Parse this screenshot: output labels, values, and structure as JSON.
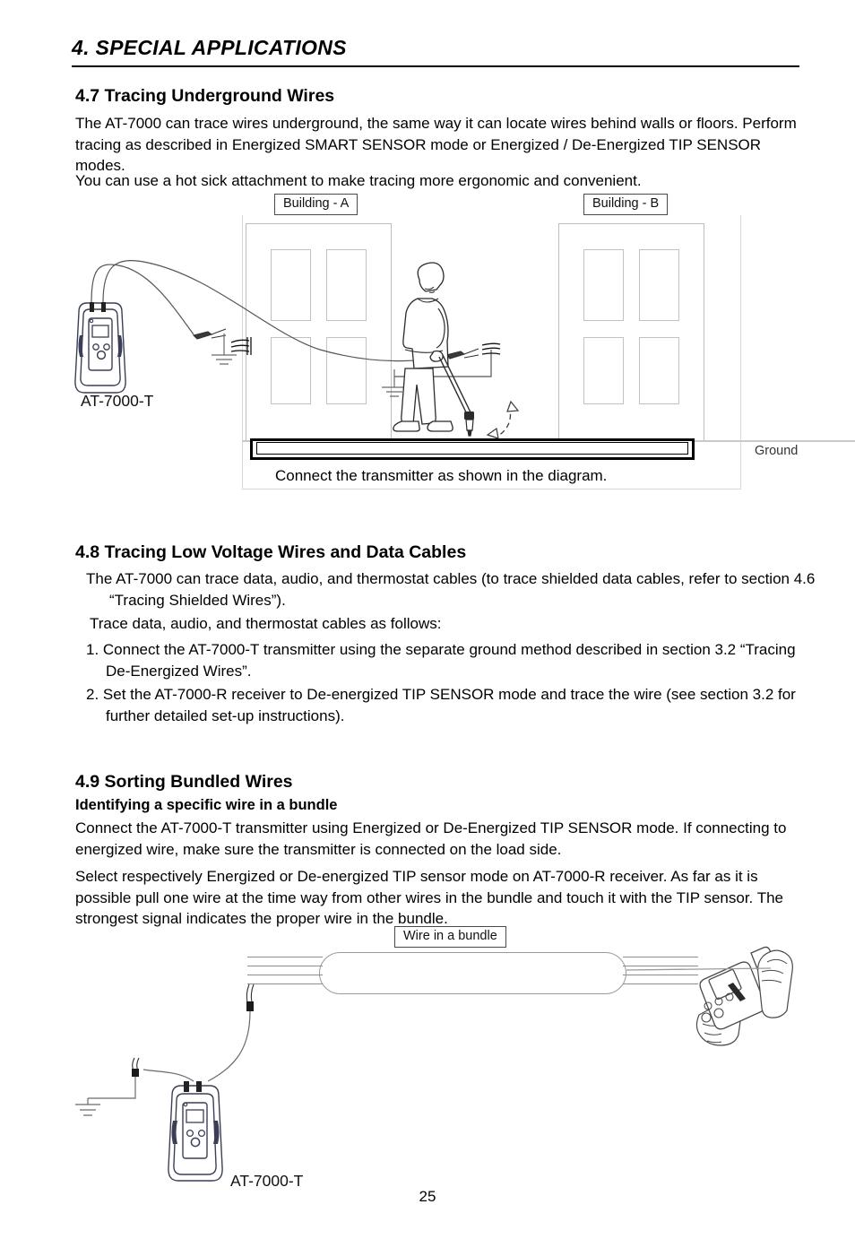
{
  "document": {
    "chapter_title": "4. SPECIAL APPLICATIONS",
    "page_number": "25"
  },
  "section_4_7": {
    "heading": "4.7 Tracing Underground Wires",
    "paragraphs": [
      "The AT-7000 can trace wires underground, the same way it can locate wires behind walls or floors. Perform tracing as described in Energized SMART SENSOR mode or Energized / De-Energized TIP SENSOR modes.",
      "You can use a hot sick attachment to make tracing more ergonomic and convenient."
    ],
    "figure": {
      "building_a_label": "Building - A",
      "building_b_label": "Building - B",
      "transmitter_label": "AT-7000-T",
      "ground_label": "Ground",
      "caption": "Connect the transmitter as shown in the diagram."
    }
  },
  "section_4_8": {
    "heading": "4.8 Tracing Low Voltage Wires and Data Cables",
    "paragraphs": [
      "The AT-7000 can trace  data, audio, and thermostat cables (to trace shielded data cables, refer to section 4.6 “Tracing Shielded Wires”).",
      "Trace data, audio, and thermostat cables as follows:"
    ],
    "steps": [
      "1. Connect the AT-7000-T transmitter using the separate ground method described in section 3.2 “Tracing De-Energized Wires”.",
      "2. Set the  AT-7000-R receiver to De-energized TIP SENSOR mode and trace the wire (see section 3.2 for further detailed set-up instructions)."
    ]
  },
  "section_4_9": {
    "heading": "4.9 Sorting Bundled Wires",
    "subheading": "Identifying a specific wire in a bundle",
    "paragraphs": [
      "Connect the AT-7000-T transmitter using Energized or De-Energized TIP SENSOR mode. If connecting to energized wire, make sure the transmitter is connected on the load side.",
      "Select respectively Energized or De-energized TIP sensor mode on AT-7000-R receiver.  As far as it is possible pull one wire at the time way from other wires in the bundle and touch it with the TIP sensor. The strongest signal indicates the proper wire in the bundle."
    ],
    "figure": {
      "bundle_label": "Wire in a bundle",
      "transmitter_label": "AT-7000-T"
    }
  },
  "colors": {
    "text": "#000000",
    "device_outline": "#3b3f56",
    "line_gray": "#8c8c8c",
    "building_gray": "#bdbdbd"
  }
}
